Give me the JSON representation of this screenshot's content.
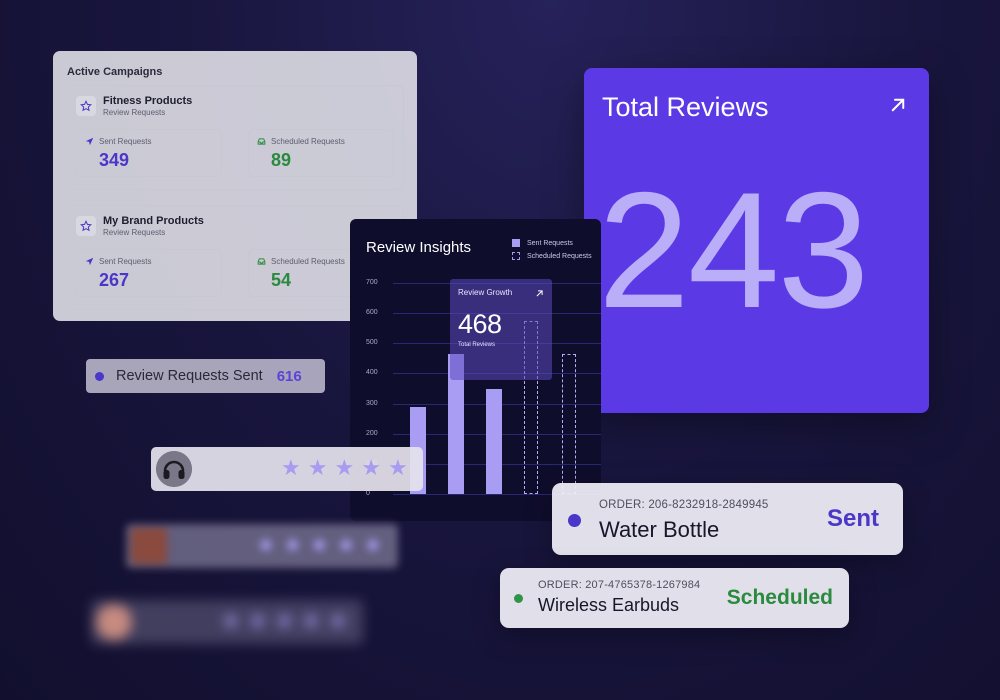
{
  "campaigns": {
    "title": "Active Campaigns",
    "items": [
      {
        "name": "Fitness Products",
        "subtitle": "Review Requests",
        "sent_label": "Sent Requests",
        "sent_value": "349",
        "scheduled_label": "Scheduled Requests",
        "scheduled_value": "89"
      },
      {
        "name": "My Brand Products",
        "subtitle": "Review Requests",
        "sent_label": "Sent Requests",
        "sent_value": "267",
        "scheduled_label": "Scheduled Requests",
        "scheduled_value": "54"
      }
    ]
  },
  "total_reviews": {
    "title": "Total Reviews",
    "value": "243"
  },
  "review_requests": {
    "label": "Review Requests Sent",
    "count": "616"
  },
  "insights": {
    "title": "Review Insights",
    "legend": [
      "Sent Requests",
      "Scheduled Requests"
    ],
    "growth": {
      "title": "Review Growth",
      "value": "468",
      "subtitle": "Total Reviews"
    }
  },
  "chart_data": {
    "type": "bar",
    "yticks": [
      "700",
      "600",
      "500",
      "400",
      "300",
      "200",
      "100",
      "0"
    ],
    "ylim": [
      0,
      700
    ],
    "series": [
      {
        "name": "Sent Requests",
        "values": [
          290,
          465,
          350,
          null,
          null
        ]
      },
      {
        "name": "Scheduled Requests",
        "values": [
          null,
          null,
          null,
          575,
          465
        ]
      }
    ]
  },
  "ratings": [
    {
      "stars": 5,
      "avatar": "headphones-icon"
    },
    {
      "stars": 5,
      "avatar": "person-icon"
    },
    {
      "stars": 5,
      "avatar": "person-icon"
    }
  ],
  "orders": [
    {
      "id": "ORDER: 206-8232918-2849945",
      "product": "Water Bottle",
      "status": "Sent"
    },
    {
      "id": "ORDER: 207-4765378-1267984",
      "product": "Wireless Earbuds",
      "status": "Scheduled"
    }
  ],
  "colors": {
    "accent": "#5b3ae6",
    "sent": "#4a37c8",
    "scheduled": "#2a8a3e",
    "bar": "#a99cf3",
    "star": "#a89cf0"
  }
}
